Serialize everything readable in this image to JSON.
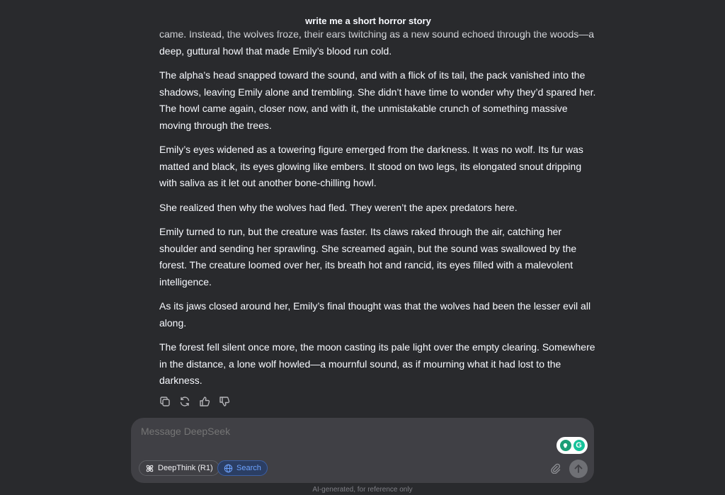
{
  "header": {
    "title": "write me a short horror story"
  },
  "message": {
    "paragraphs": [
      "came. Instead, the wolves froze, their ears twitching as a new sound echoed through the woods—a deep, guttural howl that made Emily’s blood run cold.",
      "The alpha’s head snapped toward the sound, and with a flick of its tail, the pack vanished into the shadows, leaving Emily alone and trembling. She didn’t have time to wonder why they’d spared her. The howl came again, closer now, and with it, the unmistakable crunch of something massive moving through the trees.",
      "Emily’s eyes widened as a towering figure emerged from the darkness. It was no wolf. Its fur was matted and black, its eyes glowing like embers. It stood on two legs, its elongated snout dripping with saliva as it let out another bone-chilling howl.",
      "She realized then why the wolves had fled. They weren’t the apex predators here.",
      "Emily turned to run, but the creature was faster. Its claws raked through the air, catching her shoulder and sending her sprawling. She screamed again, but the sound was swallowed by the forest. The creature loomed over her, its breath hot and rancid, its eyes filled with a malevolent intelligence.",
      "As its jaws closed around her, Emily’s final thought was that the wolves had been the lesser evil all along.",
      "The forest fell silent once more, the moon casting its pale light over the empty clearing. Somewhere in the distance, a lone wolf howled—a mournful sound, as if mourning what it had lost to the darkness."
    ],
    "actions": [
      {
        "icon": "copy-icon"
      },
      {
        "icon": "regenerate-icon"
      },
      {
        "icon": "thumbs-up-icon"
      },
      {
        "icon": "thumbs-down-icon"
      }
    ]
  },
  "composer": {
    "placeholder": "Message DeepSeek",
    "deepthink_label": "DeepThink (R1)",
    "search_label": "Search",
    "grammarly_letter": "G",
    "search_active": true,
    "colors": {
      "search_accent": "#6ea3ff",
      "grammarly": "#15c39a"
    }
  },
  "footer": {
    "disclaimer": "AI-generated, for reference only"
  }
}
